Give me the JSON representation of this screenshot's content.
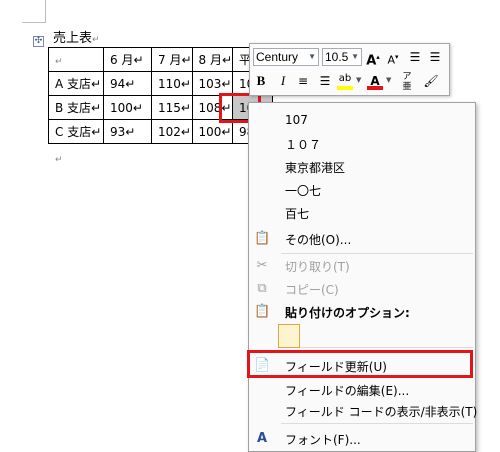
{
  "document": {
    "title": "売上表",
    "para_mark": "↵",
    "headers": [
      "↵",
      "6 月↵",
      "7 月↵",
      "8 月↵",
      "平均"
    ],
    "rows": [
      {
        "store": "A 支店↵",
        "m6": "94↵",
        "m7": "110↵",
        "m8": "103↵",
        "avg": "102"
      },
      {
        "store": "B 支店↵",
        "m6": "100↵",
        "m7": "115↵",
        "m8": "108↵",
        "avg": "107"
      },
      {
        "store": "C 支店↵",
        "m6": "93↵",
        "m7": "102↵",
        "m8": "100↵",
        "avg": "98."
      }
    ]
  },
  "minitoolbar": {
    "font_name": "Century",
    "font_size": "10.5",
    "grow": "A",
    "shrink": "A",
    "bold": "B",
    "italic": "I",
    "highlight_glyph": "ab",
    "font_color_glyph": "A"
  },
  "context_menu": {
    "items": {
      "n1": "107",
      "n2": "１０７",
      "n3": "東京都港区",
      "n4": "一〇七",
      "n5": "百七",
      "other": "その他(O)...",
      "cut": "切り取り(T)",
      "copy": "コピー(C)",
      "paste_options": "貼り付けのオプション:",
      "update_field": "フィールド更新(U)",
      "edit_field": "フィールドの編集(E)...",
      "toggle_codes": "フィールド コードの表示/非表示(T)",
      "font": "フォント(F)..."
    }
  },
  "colors": {
    "highlight_red": "#e4141b",
    "highlighter_yellow": "#ffff00",
    "font_color_red": "#e4141b"
  }
}
